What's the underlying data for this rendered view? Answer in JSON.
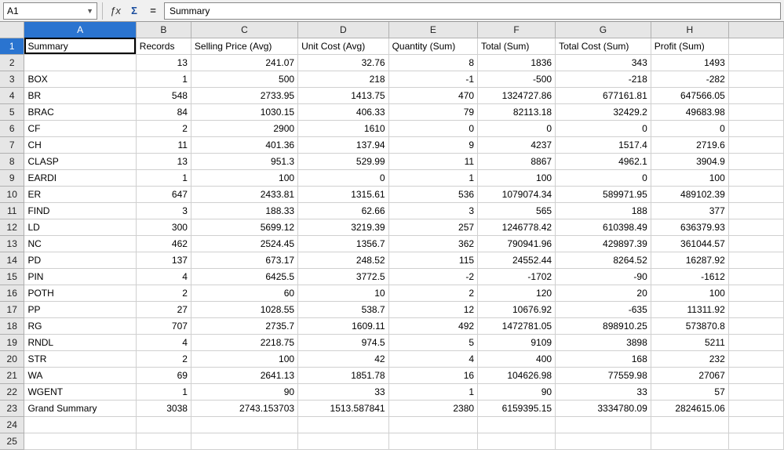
{
  "formula_bar": {
    "name_box": "A1",
    "formula_value": "Summary"
  },
  "columns": [
    "A",
    "B",
    "C",
    "D",
    "E",
    "F",
    "G",
    "H"
  ],
  "active_col": "A",
  "active_row": 1,
  "headers": [
    "Summary",
    "Records",
    "Selling Price (Avg)",
    "Unit Cost (Avg)",
    "Quantity (Sum)",
    "Total (Sum)",
    "Total Cost (Sum)",
    "Profit (Sum)"
  ],
  "rows": [
    [
      "",
      "13",
      "241.07",
      "32.76",
      "8",
      "1836",
      "343",
      "1493"
    ],
    [
      "BOX",
      "1",
      "500",
      "218",
      "-1",
      "-500",
      "-218",
      "-282"
    ],
    [
      "BR",
      "548",
      "2733.95",
      "1413.75",
      "470",
      "1324727.86",
      "677161.81",
      "647566.05"
    ],
    [
      "BRAC",
      "84",
      "1030.15",
      "406.33",
      "79",
      "82113.18",
      "32429.2",
      "49683.98"
    ],
    [
      "CF",
      "2",
      "2900",
      "1610",
      "0",
      "0",
      "0",
      "0"
    ],
    [
      "CH",
      "11",
      "401.36",
      "137.94",
      "9",
      "4237",
      "1517.4",
      "2719.6"
    ],
    [
      "CLASP",
      "13",
      "951.3",
      "529.99",
      "11",
      "8867",
      "4962.1",
      "3904.9"
    ],
    [
      "EARDI",
      "1",
      "100",
      "0",
      "1",
      "100",
      "0",
      "100"
    ],
    [
      "ER",
      "647",
      "2433.81",
      "1315.61",
      "536",
      "1079074.34",
      "589971.95",
      "489102.39"
    ],
    [
      "FIND",
      "3",
      "188.33",
      "62.66",
      "3",
      "565",
      "188",
      "377"
    ],
    [
      "LD",
      "300",
      "5699.12",
      "3219.39",
      "257",
      "1246778.42",
      "610398.49",
      "636379.93"
    ],
    [
      "NC",
      "462",
      "2524.45",
      "1356.7",
      "362",
      "790941.96",
      "429897.39",
      "361044.57"
    ],
    [
      "PD",
      "137",
      "673.17",
      "248.52",
      "115",
      "24552.44",
      "8264.52",
      "16287.92"
    ],
    [
      "PIN",
      "4",
      "6425.5",
      "3772.5",
      "-2",
      "-1702",
      "-90",
      "-1612"
    ],
    [
      "POTH",
      "2",
      "60",
      "10",
      "2",
      "120",
      "20",
      "100"
    ],
    [
      "PP",
      "27",
      "1028.55",
      "538.7",
      "12",
      "10676.92",
      "-635",
      "11311.92"
    ],
    [
      "RG",
      "707",
      "2735.7",
      "1609.11",
      "492",
      "1472781.05",
      "898910.25",
      "573870.8"
    ],
    [
      "RNDL",
      "4",
      "2218.75",
      "974.5",
      "5",
      "9109",
      "3898",
      "5211"
    ],
    [
      "STR",
      "2",
      "100",
      "42",
      "4",
      "400",
      "168",
      "232"
    ],
    [
      "WA",
      "69",
      "2641.13",
      "1851.78",
      "16",
      "104626.98",
      "77559.98",
      "27067"
    ],
    [
      "WGENT",
      "1",
      "90",
      "33",
      "1",
      "90",
      "33",
      "57"
    ],
    [
      "Grand Summary",
      "3038",
      "2743.153703",
      "1513.587841",
      "2380",
      "6159395.15",
      "3334780.09",
      "2824615.06"
    ]
  ],
  "empty_rows": 2,
  "chart_data": {
    "type": "table",
    "title": "Summary",
    "columns": [
      "Summary",
      "Records",
      "Selling Price (Avg)",
      "Unit Cost (Avg)",
      "Quantity (Sum)",
      "Total (Sum)",
      "Total Cost (Sum)",
      "Profit (Sum)"
    ],
    "data": [
      {
        "Summary": "",
        "Records": 13,
        "Selling Price (Avg)": 241.07,
        "Unit Cost (Avg)": 32.76,
        "Quantity (Sum)": 8,
        "Total (Sum)": 1836,
        "Total Cost (Sum)": 343,
        "Profit (Sum)": 1493
      },
      {
        "Summary": "BOX",
        "Records": 1,
        "Selling Price (Avg)": 500,
        "Unit Cost (Avg)": 218,
        "Quantity (Sum)": -1,
        "Total (Sum)": -500,
        "Total Cost (Sum)": -218,
        "Profit (Sum)": -282
      },
      {
        "Summary": "BR",
        "Records": 548,
        "Selling Price (Avg)": 2733.95,
        "Unit Cost (Avg)": 1413.75,
        "Quantity (Sum)": 470,
        "Total (Sum)": 1324727.86,
        "Total Cost (Sum)": 677161.81,
        "Profit (Sum)": 647566.05
      },
      {
        "Summary": "BRAC",
        "Records": 84,
        "Selling Price (Avg)": 1030.15,
        "Unit Cost (Avg)": 406.33,
        "Quantity (Sum)": 79,
        "Total (Sum)": 82113.18,
        "Total Cost (Sum)": 32429.2,
        "Profit (Sum)": 49683.98
      },
      {
        "Summary": "CF",
        "Records": 2,
        "Selling Price (Avg)": 2900,
        "Unit Cost (Avg)": 1610,
        "Quantity (Sum)": 0,
        "Total (Sum)": 0,
        "Total Cost (Sum)": 0,
        "Profit (Sum)": 0
      },
      {
        "Summary": "CH",
        "Records": 11,
        "Selling Price (Avg)": 401.36,
        "Unit Cost (Avg)": 137.94,
        "Quantity (Sum)": 9,
        "Total (Sum)": 4237,
        "Total Cost (Sum)": 1517.4,
        "Profit (Sum)": 2719.6
      },
      {
        "Summary": "CLASP",
        "Records": 13,
        "Selling Price (Avg)": 951.3,
        "Unit Cost (Avg)": 529.99,
        "Quantity (Sum)": 11,
        "Total (Sum)": 8867,
        "Total Cost (Sum)": 4962.1,
        "Profit (Sum)": 3904.9
      },
      {
        "Summary": "EARDI",
        "Records": 1,
        "Selling Price (Avg)": 100,
        "Unit Cost (Avg)": 0,
        "Quantity (Sum)": 1,
        "Total (Sum)": 100,
        "Total Cost (Sum)": 0,
        "Profit (Sum)": 100
      },
      {
        "Summary": "ER",
        "Records": 647,
        "Selling Price (Avg)": 2433.81,
        "Unit Cost (Avg)": 1315.61,
        "Quantity (Sum)": 536,
        "Total (Sum)": 1079074.34,
        "Total Cost (Sum)": 589971.95,
        "Profit (Sum)": 489102.39
      },
      {
        "Summary": "FIND",
        "Records": 3,
        "Selling Price (Avg)": 188.33,
        "Unit Cost (Avg)": 62.66,
        "Quantity (Sum)": 3,
        "Total (Sum)": 565,
        "Total Cost (Sum)": 188,
        "Profit (Sum)": 377
      },
      {
        "Summary": "LD",
        "Records": 300,
        "Selling Price (Avg)": 5699.12,
        "Unit Cost (Avg)": 3219.39,
        "Quantity (Sum)": 257,
        "Total (Sum)": 1246778.42,
        "Total Cost (Sum)": 610398.49,
        "Profit (Sum)": 636379.93
      },
      {
        "Summary": "NC",
        "Records": 462,
        "Selling Price (Avg)": 2524.45,
        "Unit Cost (Avg)": 1356.7,
        "Quantity (Sum)": 362,
        "Total (Sum)": 790941.96,
        "Total Cost (Sum)": 429897.39,
        "Profit (Sum)": 361044.57
      },
      {
        "Summary": "PD",
        "Records": 137,
        "Selling Price (Avg)": 673.17,
        "Unit Cost (Avg)": 248.52,
        "Quantity (Sum)": 115,
        "Total (Sum)": 24552.44,
        "Total Cost (Sum)": 8264.52,
        "Profit (Sum)": 16287.92
      },
      {
        "Summary": "PIN",
        "Records": 4,
        "Selling Price (Avg)": 6425.5,
        "Unit Cost (Avg)": 3772.5,
        "Quantity (Sum)": -2,
        "Total (Sum)": -1702,
        "Total Cost (Sum)": -90,
        "Profit (Sum)": -1612
      },
      {
        "Summary": "POTH",
        "Records": 2,
        "Selling Price (Avg)": 60,
        "Unit Cost (Avg)": 10,
        "Quantity (Sum)": 2,
        "Total (Sum)": 120,
        "Total Cost (Sum)": 20,
        "Profit (Sum)": 100
      },
      {
        "Summary": "PP",
        "Records": 27,
        "Selling Price (Avg)": 1028.55,
        "Unit Cost (Avg)": 538.7,
        "Quantity (Sum)": 12,
        "Total (Sum)": 10676.92,
        "Total Cost (Sum)": -635,
        "Profit (Sum)": 11311.92
      },
      {
        "Summary": "RG",
        "Records": 707,
        "Selling Price (Avg)": 2735.7,
        "Unit Cost (Avg)": 1609.11,
        "Quantity (Sum)": 492,
        "Total (Sum)": 1472781.05,
        "Total Cost (Sum)": 898910.25,
        "Profit (Sum)": 573870.8
      },
      {
        "Summary": "RNDL",
        "Records": 4,
        "Selling Price (Avg)": 2218.75,
        "Unit Cost (Avg)": 974.5,
        "Quantity (Sum)": 5,
        "Total (Sum)": 9109,
        "Total Cost (Sum)": 3898,
        "Profit (Sum)": 5211
      },
      {
        "Summary": "STR",
        "Records": 2,
        "Selling Price (Avg)": 100,
        "Unit Cost (Avg)": 42,
        "Quantity (Sum)": 4,
        "Total (Sum)": 400,
        "Total Cost (Sum)": 168,
        "Profit (Sum)": 232
      },
      {
        "Summary": "WA",
        "Records": 69,
        "Selling Price (Avg)": 2641.13,
        "Unit Cost (Avg)": 1851.78,
        "Quantity (Sum)": 16,
        "Total (Sum)": 104626.98,
        "Total Cost (Sum)": 77559.98,
        "Profit (Sum)": 27067
      },
      {
        "Summary": "WGENT",
        "Records": 1,
        "Selling Price (Avg)": 90,
        "Unit Cost (Avg)": 33,
        "Quantity (Sum)": 1,
        "Total (Sum)": 90,
        "Total Cost (Sum)": 33,
        "Profit (Sum)": 57
      },
      {
        "Summary": "Grand Summary",
        "Records": 3038,
        "Selling Price (Avg)": 2743.153703,
        "Unit Cost (Avg)": 1513.587841,
        "Quantity (Sum)": 2380,
        "Total (Sum)": 6159395.15,
        "Total Cost (Sum)": 3334780.09,
        "Profit (Sum)": 2824615.06
      }
    ]
  }
}
